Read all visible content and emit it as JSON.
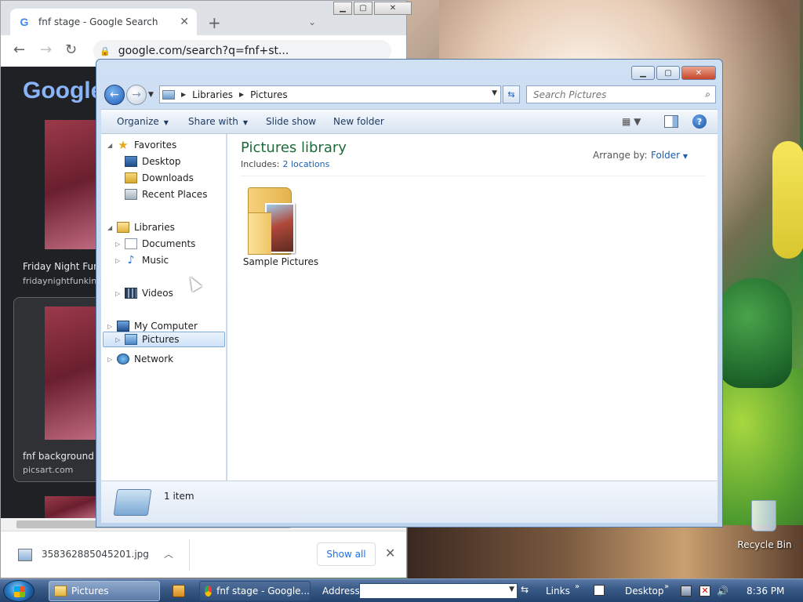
{
  "chrome": {
    "tab_title": "fnf stage - Google Search",
    "tab_close": "✕",
    "new_tab": "+",
    "tab_dropdown": "⌄",
    "url": "google.com/search?q=fnf+st...",
    "google_logo": "Google",
    "results": [
      {
        "title": "Friday Night Funk",
        "site": "fridaynightfunkin.fi"
      },
      {
        "title": "fnf background s",
        "site": "picsart.com"
      }
    ],
    "download": {
      "filename": "358362885045201.jpg",
      "show_all": "Show all",
      "close": "✕"
    }
  },
  "explorer": {
    "breadcrumb": [
      "Libraries",
      "Pictures"
    ],
    "search_placeholder": "Search Pictures",
    "commands": {
      "organize": "Organize",
      "share_with": "Share with",
      "slide_show": "Slide show",
      "new_folder": "New folder"
    },
    "nav": {
      "favorites": "Favorites",
      "desktop": "Desktop",
      "downloads": "Downloads",
      "recent_places": "Recent Places",
      "libraries": "Libraries",
      "documents": "Documents",
      "music": "Music",
      "pictures": "Pictures",
      "videos": "Videos",
      "my_computer": "My Computer",
      "network": "Network"
    },
    "library_title": "Pictures library",
    "includes_label": "Includes:",
    "includes_link": "2 locations",
    "arrange_label": "Arrange by:",
    "arrange_value": "Folder",
    "items": [
      {
        "name": "Sample Pictures"
      }
    ],
    "details": "1 item"
  },
  "desktop": {
    "recycle_bin": "Recycle Bin"
  },
  "taskbar": {
    "pictures": "Pictures",
    "chrome": "fnf stage - Google...",
    "address_label": "Address",
    "links_label": "Links",
    "desktop_label": "Desktop",
    "clock": "8:36 PM"
  }
}
